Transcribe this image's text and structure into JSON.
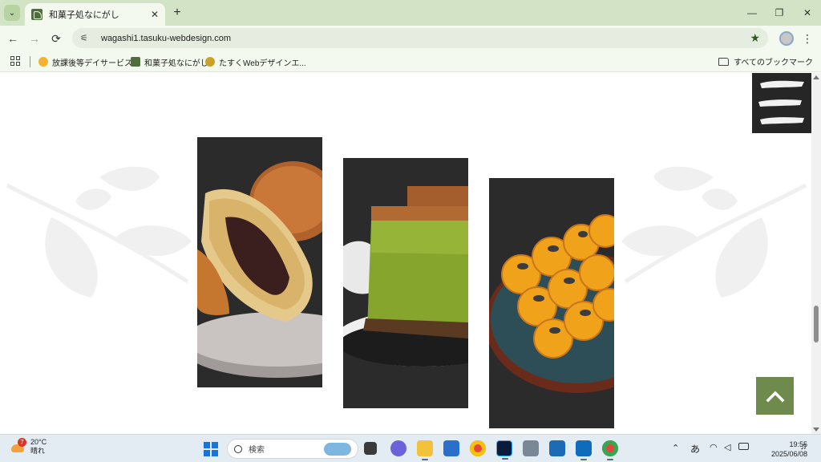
{
  "browser": {
    "tab_title": "和菓子処なにがし",
    "url": "wagashi1.tasuku-webdesign.com",
    "bookmarks": [
      {
        "label": "放課後等デイサービス...",
        "color": "#f2b233"
      },
      {
        "label": "和菓子処なにがし",
        "color": "#4f6e3d"
      },
      {
        "label": "たすくWebデザインエ...",
        "color": "#c9a227"
      }
    ],
    "all_bookmarks_label": "すべてのブックマーク"
  },
  "page": {
    "photos": [
      {
        "name": "dorayaki-photo",
        "subject": "dorayaki"
      },
      {
        "name": "matcha-castella-photo",
        "subject": "matcha castella"
      },
      {
        "name": "mitarashi-dango-photo",
        "subject": "mitarashi dango"
      }
    ],
    "colors": {
      "accent": "#6e8b4d",
      "menu_bg": "#262626",
      "photo_bg": "#2b2b2b"
    }
  },
  "taskbar": {
    "weather_temp": "20°C",
    "weather_desc": "晴れ",
    "weather_badge": "7",
    "search_placeholder": "検索",
    "ime": "あ",
    "time": "19:55",
    "date": "2025/06/08"
  }
}
